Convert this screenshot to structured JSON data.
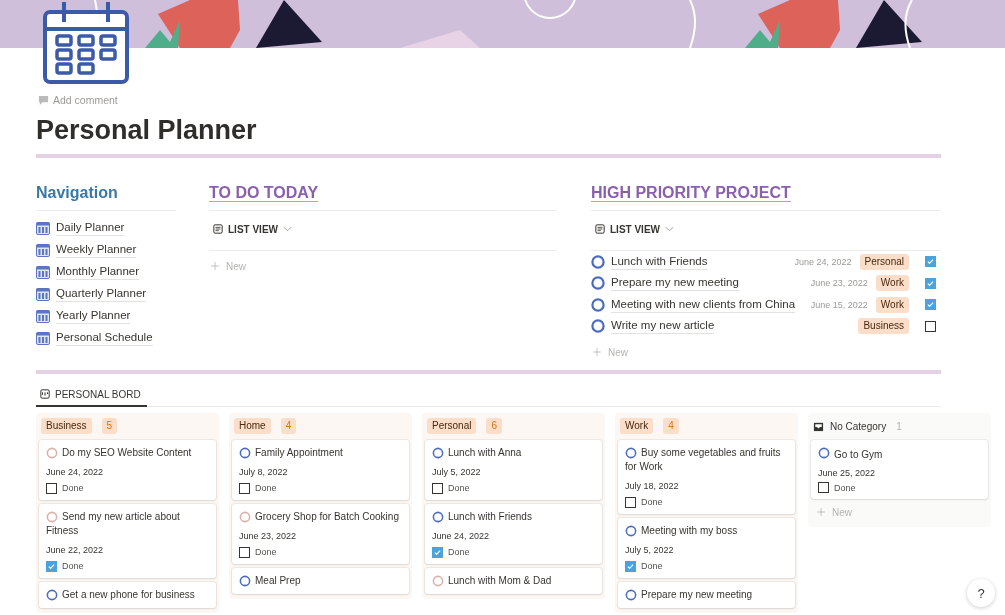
{
  "add_comment": "Add comment",
  "title": "Personal Planner",
  "navigation": {
    "heading": "Navigation",
    "items": [
      "Daily Planner",
      "Weekly Planner",
      "Monthly Planner",
      "Quarterly Planner",
      "Yearly Planner",
      "Personal Schedule"
    ]
  },
  "todo_today": {
    "heading": "TO DO TODAY",
    "view": "LIST VIEW",
    "new_label": "New"
  },
  "high_priority": {
    "heading": "HIGH PRIORITY PROJECT",
    "view": "LIST VIEW",
    "new_label": "New",
    "items": [
      {
        "title": "Lunch with Friends",
        "date": "June 24, 2022",
        "tag": "Personal",
        "done": true
      },
      {
        "title": "Prepare my new meeting",
        "date": "June 23, 2022",
        "tag": "Work",
        "done": true
      },
      {
        "title": "Meeting with new clients from China",
        "date": "June 15, 2022",
        "tag": "Work",
        "done": true
      },
      {
        "title": "Write my new article",
        "tag": "Business",
        "done": false
      }
    ]
  },
  "board": {
    "tab": "PERSONAL BORD",
    "columns": [
      {
        "kind": "tag",
        "label": "Business",
        "count": "5",
        "cards": [
          {
            "title": "Do my SEO Website Content",
            "date": "June 24, 2022",
            "done_label": "Done",
            "done": false,
            "color": "#d9b1a8"
          },
          {
            "title": "Send my new article about Fitness",
            "date": "June 22, 2022",
            "done_label": "Done",
            "done": true,
            "color": "#d9b1a8"
          },
          {
            "title": "Get a new phone for business",
            "color": "#4a6cc0"
          }
        ]
      },
      {
        "kind": "tag",
        "label": "Home",
        "count": "4",
        "cards": [
          {
            "title": "Family Appointment",
            "date": "July 8, 2022",
            "done_label": "Done",
            "done": false,
            "color": "#4a6cc0"
          },
          {
            "title": "Grocery Shop for Batch Cooking",
            "date": "June 23, 2022",
            "done_label": "Done",
            "done": false,
            "color": "#d9b1a8"
          },
          {
            "title": "Meal Prep",
            "color": "#4a6cc0"
          }
        ]
      },
      {
        "kind": "tag",
        "label": "Personal",
        "count": "6",
        "cards": [
          {
            "title": "Lunch with Anna",
            "date": "July 5, 2022",
            "done_label": "Done",
            "done": false,
            "color": "#4a6cc0"
          },
          {
            "title": "Lunch with Friends",
            "date": "June 24, 2022",
            "done_label": "Done",
            "done": true,
            "color": "#4a6cc0"
          },
          {
            "title": "Lunch with Mom & Dad",
            "color": "#d9b1a8"
          }
        ]
      },
      {
        "kind": "tag",
        "label": "Work",
        "count": "4",
        "cards": [
          {
            "title": "Buy some vegetables and fruits for Work",
            "date": "July 18, 2022",
            "done_label": "Done",
            "done": false,
            "color": "#4a6cc0"
          },
          {
            "title": "Meeting with my boss",
            "date": "July 5, 2022",
            "done_label": "Done",
            "done": true,
            "color": "#4a6cc0"
          },
          {
            "title": "Prepare my new meeting",
            "color": "#4a6cc0"
          }
        ]
      },
      {
        "kind": "none",
        "label": "No Category",
        "count": "1",
        "new_label": "New",
        "cards": [
          {
            "title": "Go to Gym",
            "date": "June 25, 2022",
            "done_label": "Done",
            "done": false,
            "color": "#4a6cc0"
          }
        ]
      }
    ]
  },
  "help": "?"
}
